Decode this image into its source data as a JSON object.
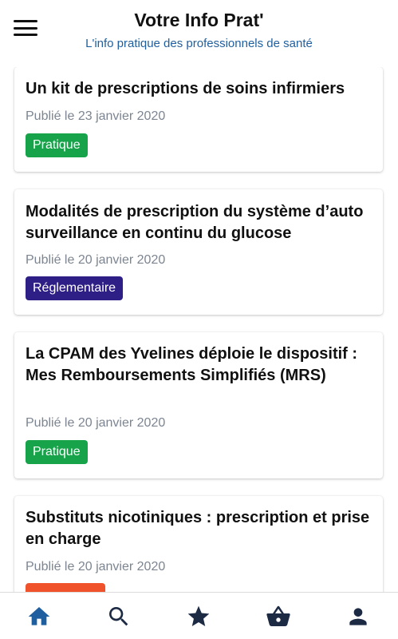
{
  "header": {
    "title": "Votre Info Prat'",
    "subtitle": "L'info pratique des professionnels de santé"
  },
  "articles": [
    {
      "title": "Un kit de prescriptions de soins infirmiers",
      "date": "Publié le 23 janvier 2020",
      "tag": "Pratique",
      "tag_color": "#16a34a"
    },
    {
      "title": "Modalités de prescription du système d’auto surveillance en continu du glucose",
      "date": "Publié le 20 janvier 2020",
      "tag": "Réglementaire",
      "tag_color": "#2e1f87"
    },
    {
      "title": "La CPAM des Yvelines déploie le dispositif : Mes Remboursements Simplifiés (MRS)",
      "date": "Publié le 20 janvier 2020",
      "tag": "Pratique",
      "tag_color": "#16a34a"
    },
    {
      "title": "Substituts nicotiniques : prescription et prise en charge",
      "date": "Publié le 20 janvier 2020",
      "tag": "",
      "tag_color": "#f0522b"
    }
  ],
  "bottom_nav": {
    "items": [
      {
        "icon": "home-icon",
        "active": true
      },
      {
        "icon": "search-icon",
        "active": false
      },
      {
        "icon": "star-icon",
        "active": false
      },
      {
        "icon": "basket-icon",
        "active": false
      },
      {
        "icon": "account-icon",
        "active": false
      }
    ]
  },
  "colors": {
    "nav_active": "#1f5f9f",
    "nav_inactive": "#1c2a44",
    "subtitle": "#1f5f9f"
  }
}
